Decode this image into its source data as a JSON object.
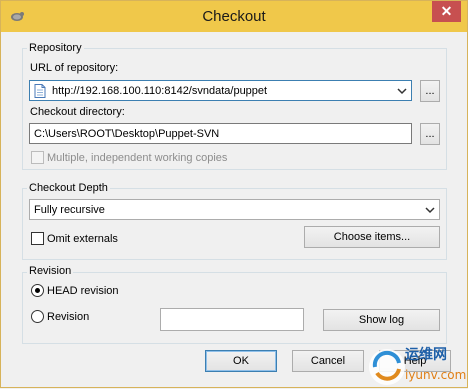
{
  "window": {
    "title": "Checkout"
  },
  "repository": {
    "group_label": "Repository",
    "url_label": "URL of repository:",
    "url_value": "http://192.168.100.110:8142/svndata/puppet",
    "checkout_dir_label": "Checkout directory:",
    "checkout_dir_value": "C:\\Users\\ROOT\\Desktop\\Puppet-SVN",
    "browse_label": "...",
    "multiple_label": "Multiple, independent working copies"
  },
  "depth": {
    "group_label": "Checkout Depth",
    "selected": "Fully recursive",
    "omit_externals_label": "Omit externals",
    "choose_items_label": "Choose items..."
  },
  "revision": {
    "group_label": "Revision",
    "head_label": "HEAD revision",
    "revision_label": "Revision",
    "revision_value": "",
    "show_log_label": "Show log"
  },
  "footer": {
    "ok_label": "OK",
    "cancel_label": "Cancel",
    "help_label": "Help"
  },
  "watermark": {
    "text1": "运维网",
    "text2": "iyunv.com"
  }
}
